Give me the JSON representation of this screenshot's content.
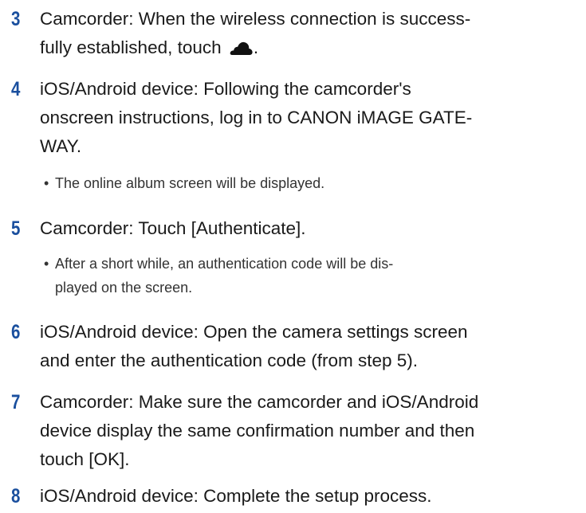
{
  "steps": [
    {
      "number": "3",
      "line1": "Camcorder: When the wireless connection is success-",
      "line2_before": "fully established, touch",
      "line2_after": ".",
      "icon": "cloud-icon"
    },
    {
      "number": "4",
      "line1": "iOS/Android device: Following the camcorder's",
      "line2": "onscreen instructions, log in to CANON iMAGE GATE-",
      "line3": "WAY.",
      "note_bullet": "•",
      "note": "The online album screen will be displayed."
    },
    {
      "number": "5",
      "line1": "Camcorder: Touch [Authenticate].",
      "note_bullet": "•",
      "note_line1": "After a short while, an authentication code will be dis-",
      "note_line2": "played on the screen."
    },
    {
      "number": "6",
      "line1": "iOS/Android device: Open the camera settings screen",
      "line2": "and enter the authentication code (from step 5)."
    },
    {
      "number": "7",
      "line1": "Camcorder: Make sure the camcorder and iOS/Android",
      "line2": "device display the same confirmation number and then",
      "line3": "touch [OK]."
    },
    {
      "number": "8",
      "line1": "iOS/Android device: Complete the setup process."
    }
  ],
  "colors": {
    "step_number": "#1a4f9e",
    "text": "#1a1a1a"
  }
}
